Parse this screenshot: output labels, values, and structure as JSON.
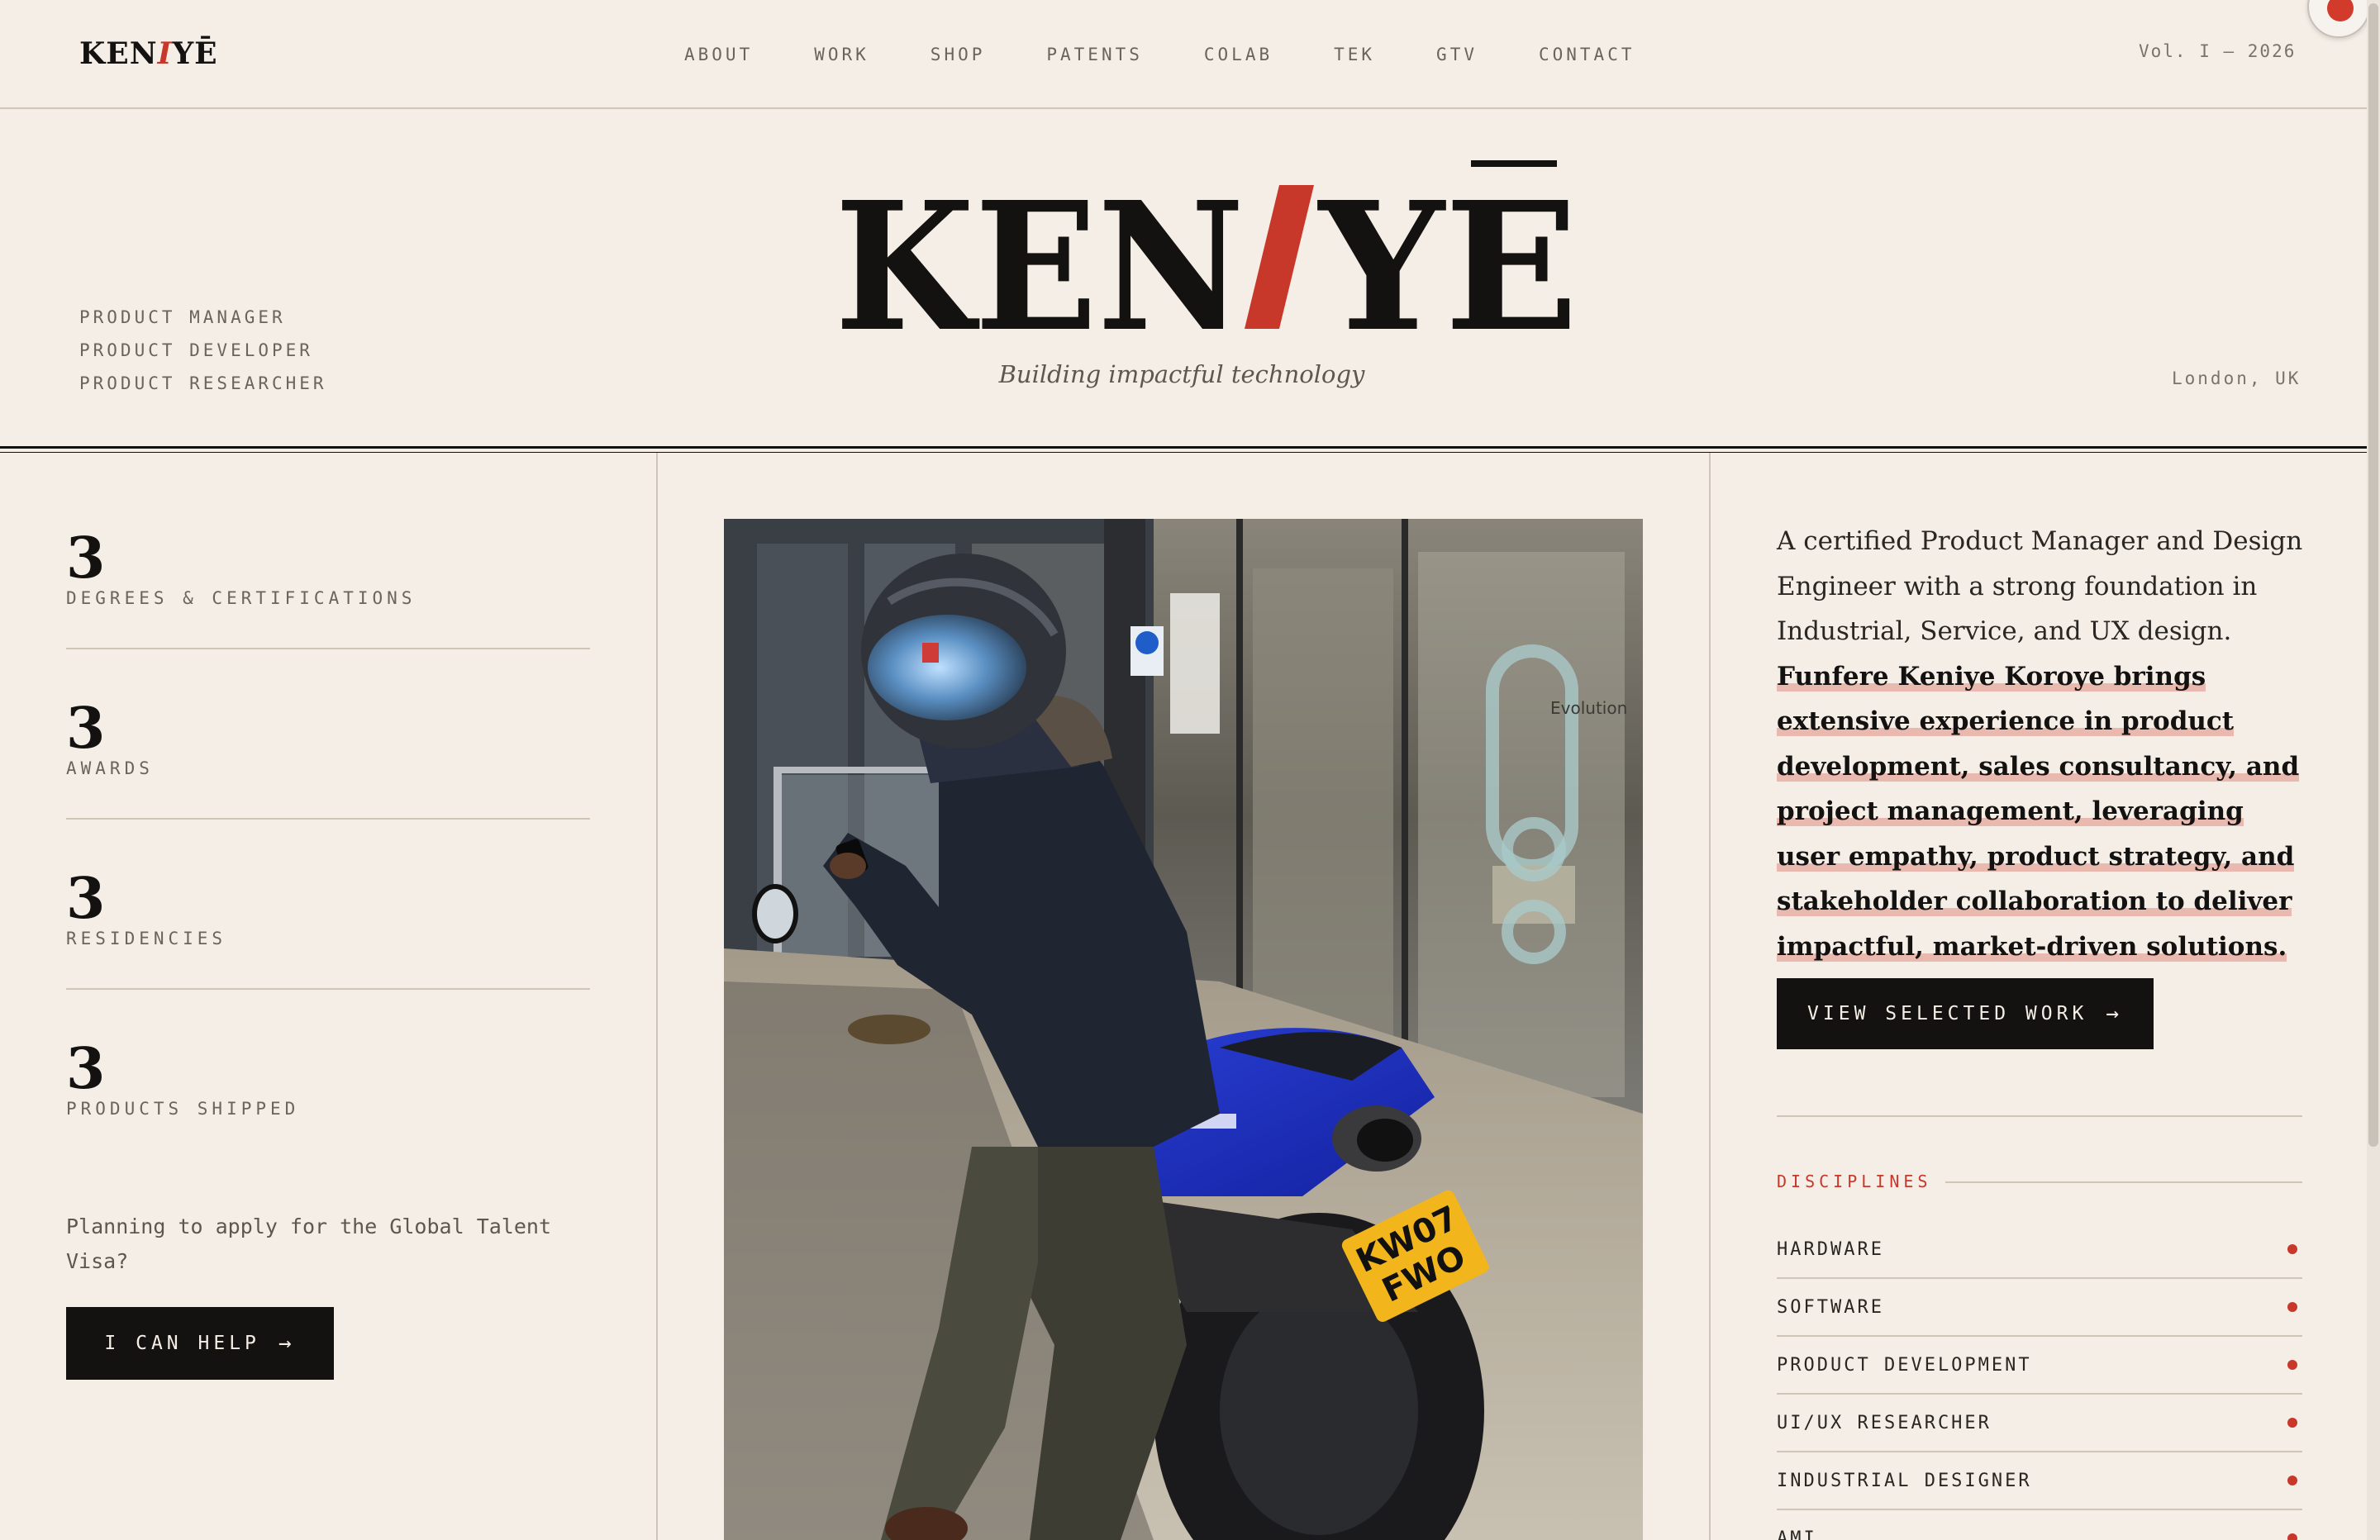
{
  "header": {
    "brand": {
      "pre": "KEN",
      "slash": "I",
      "post": "YĒ"
    },
    "nav": [
      "ABOUT",
      "WORK",
      "SHOP",
      "PATENTS",
      "COLAB",
      "TEK",
      "GTV",
      "CONTACT"
    ],
    "volume": "Vol. I — 2026"
  },
  "hero": {
    "roles": [
      "PRODUCT MANAGER",
      "PRODUCT DEVELOPER",
      "PRODUCT RESEARCHER"
    ],
    "logo": {
      "pre": "KEN",
      "slash": "I",
      "post": "YĒ"
    },
    "tagline": "Building impactful technology",
    "location": "London, UK"
  },
  "stats": [
    {
      "number": "3",
      "label": "DEGREES & CERTIFICATIONS"
    },
    {
      "number": "3",
      "label": "AWARDS"
    },
    {
      "number": "3",
      "label": "RESIDENCIES"
    },
    {
      "number": "3",
      "label": "PRODUCTS SHIPPED"
    }
  ],
  "visa": {
    "text": "Planning to apply for the Global Talent Visa?",
    "button": "I CAN HELP",
    "arrow": "→"
  },
  "photo": {
    "plate_line1": "KW07",
    "plate_line2": "FWO",
    "sign_text": "Evolution"
  },
  "bio": {
    "intro": "A certified Product Manager and Design Engineer with a strong foundation in Industrial, Service, and UX design. ",
    "highlight": "Funfere Keniye Koroye brings extensive experience in product development, sales consultancy, and project management, leveraging user empathy, product strategy, and stakeholder collaboration to deliver impactful, market-driven solutions."
  },
  "cta": {
    "label": "VIEW SELECTED WORK",
    "arrow": "→"
  },
  "disciplines": {
    "heading": "DISCIPLINES",
    "items": [
      "HARDWARE",
      "SOFTWARE",
      "PRODUCT DEVELOPMENT",
      "UI/UX RESEARCHER",
      "INDUSTRIAL DESIGNER",
      "AMI"
    ]
  },
  "colors": {
    "accent": "#c8382a",
    "ink": "#141210",
    "paper": "#f4eee7"
  }
}
